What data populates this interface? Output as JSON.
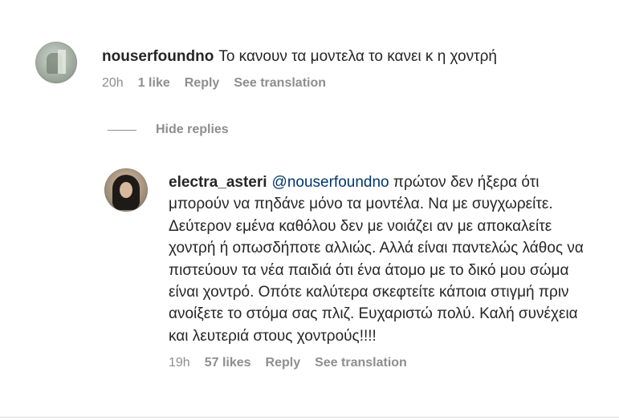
{
  "comments": [
    {
      "username": "nouserfoundno",
      "text": "Το κανουν τα μοντελα το κανει κ η χοντρή",
      "time": "20h",
      "likes": "1 like",
      "reply": "Reply",
      "translate": "See translation"
    }
  ],
  "hide_replies_label": "Hide replies",
  "replies": [
    {
      "username": "electra_asteri",
      "mention": "@nouserfoundno",
      "text": " πρώτον δεν ήξερα ότι μπορούν να πηδάνε μόνο τα μοντέλα. Να με συγχωρείτε. Δεύτερον εμένα καθόλου δεν με νοιάζει αν με αποκαλείτε χοντρή ή οπωσδήποτε αλλιώς. Αλλά είναι παντελώς λάθος να πιστεύουν τα νέα παιδιά ότι ένα άτομο με το δικό μου σώμα είναι χοντρό. Οπότε καλύτερα σκεφτείτε κάποια στιγμή πριν ανοίξετε το στόμα σας πλιζ. Ευχαριστώ πολύ. Καλή συνέχεια και λευτεριά στους χοντρούς!!!!",
      "time": "19h",
      "likes": "57 likes",
      "reply": "Reply",
      "translate": "See translation"
    }
  ]
}
